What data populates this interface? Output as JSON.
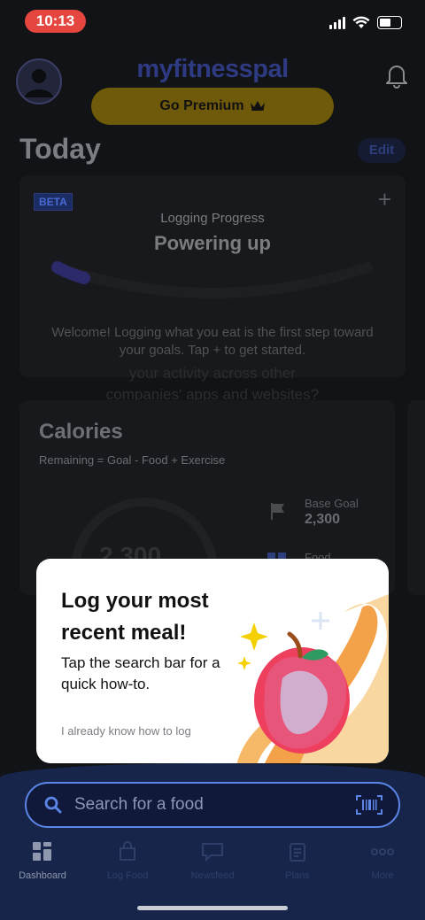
{
  "status": {
    "time": "10:13"
  },
  "header": {
    "brand": "myfitnesspal",
    "premium_label": "Go Premium"
  },
  "today": {
    "title": "Today",
    "edit_label": "Edit"
  },
  "logging_card": {
    "badge": "BETA",
    "label": "Logging Progress",
    "title": "Powering up",
    "welcome": "Welcome! Logging what you eat is the first step toward your goals. Tap + to get started."
  },
  "ghost_text": "your activity across other companies' apps and websites?",
  "calories_card": {
    "title": "Calories",
    "subtitle": "Remaining = Goal - Food + Exercise",
    "ring_value": "2,300",
    "base_goal_label": "Base Goal",
    "base_goal_value": "2,300",
    "food_label": "Food"
  },
  "popup": {
    "title": "Log your most recent meal!",
    "body": "Tap the search bar for a quick how-to.",
    "link": "I already know how to log"
  },
  "search": {
    "placeholder": "Search for a food"
  },
  "tabs": [
    {
      "label": "Dashboard",
      "icon": "dashboard-icon"
    },
    {
      "label": "Log Food",
      "icon": "log-food-icon"
    },
    {
      "label": "Newsfeed",
      "icon": "newsfeed-icon"
    },
    {
      "label": "Plans",
      "icon": "plans-icon"
    },
    {
      "label": "More",
      "icon": "more-icon"
    }
  ],
  "colors": {
    "accent": "#5b86e8",
    "premium": "#f5c518",
    "status_pill": "#e5463f"
  }
}
